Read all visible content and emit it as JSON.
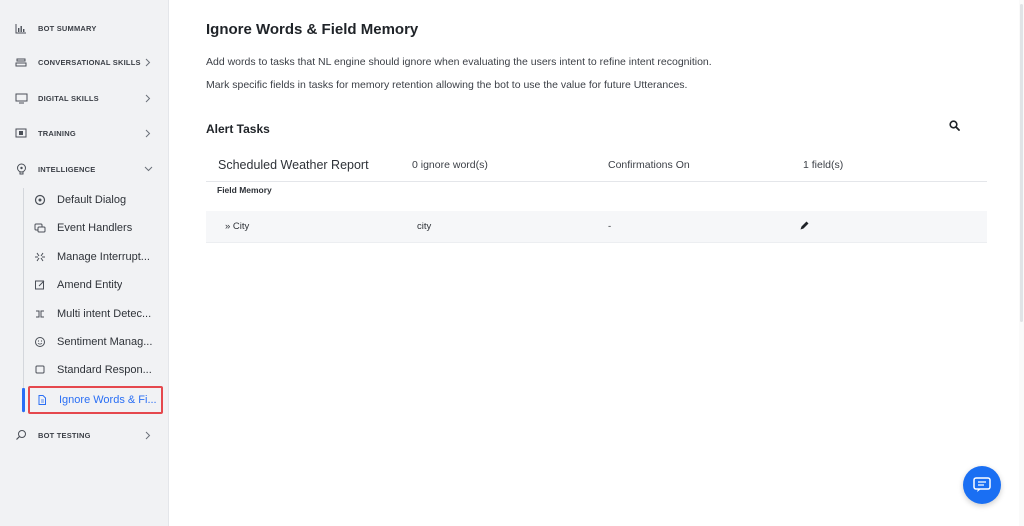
{
  "sidebar": {
    "nav": [
      {
        "label": "BOT SUMMARY",
        "icon": "bar-chart-icon"
      },
      {
        "label": "CONVERSATIONAL SKILLS",
        "icon": "stack-icon"
      },
      {
        "label": "DIGITAL SKILLS",
        "icon": "monitor-icon"
      },
      {
        "label": "TRAINING",
        "icon": "training-icon"
      },
      {
        "label": "INTELLIGENCE",
        "icon": "brain-icon"
      },
      {
        "label": "BOT TESTING",
        "icon": "magnifier-icon"
      }
    ],
    "intelligence_items": [
      {
        "label": "Default Dialog",
        "icon": "dialog-icon"
      },
      {
        "label": "Event Handlers",
        "icon": "event-icon"
      },
      {
        "label": "Manage Interrupt...",
        "icon": "interrupt-icon"
      },
      {
        "label": "Amend Entity",
        "icon": "edit-box-icon"
      },
      {
        "label": "Multi intent Detec...",
        "icon": "multi-intent-icon"
      },
      {
        "label": "Sentiment Manag...",
        "icon": "smiley-icon"
      },
      {
        "label": "Standard Respon...",
        "icon": "message-icon"
      },
      {
        "label": "Ignore Words & Fi...",
        "icon": "document-icon"
      }
    ],
    "active_color": "#2a6ff5"
  },
  "main": {
    "title": "Ignore Words & Field Memory",
    "desc1": "Add words to tasks that NL engine should ignore when evaluating the users intent to refine intent recognition.",
    "desc2": "Mark specific fields in tasks for memory retention allowing the bot to use the value for future Utterances.",
    "section_title": "Alert Tasks",
    "task": {
      "name": "Scheduled Weather Report",
      "ignore_words": "0 ignore word(s)",
      "confirmations": "Confirmations On",
      "fields": "1 field(s)"
    },
    "field_memory_label": "Field Memory",
    "field_row": {
      "name": "» City",
      "value": "city",
      "extra": "-"
    }
  }
}
